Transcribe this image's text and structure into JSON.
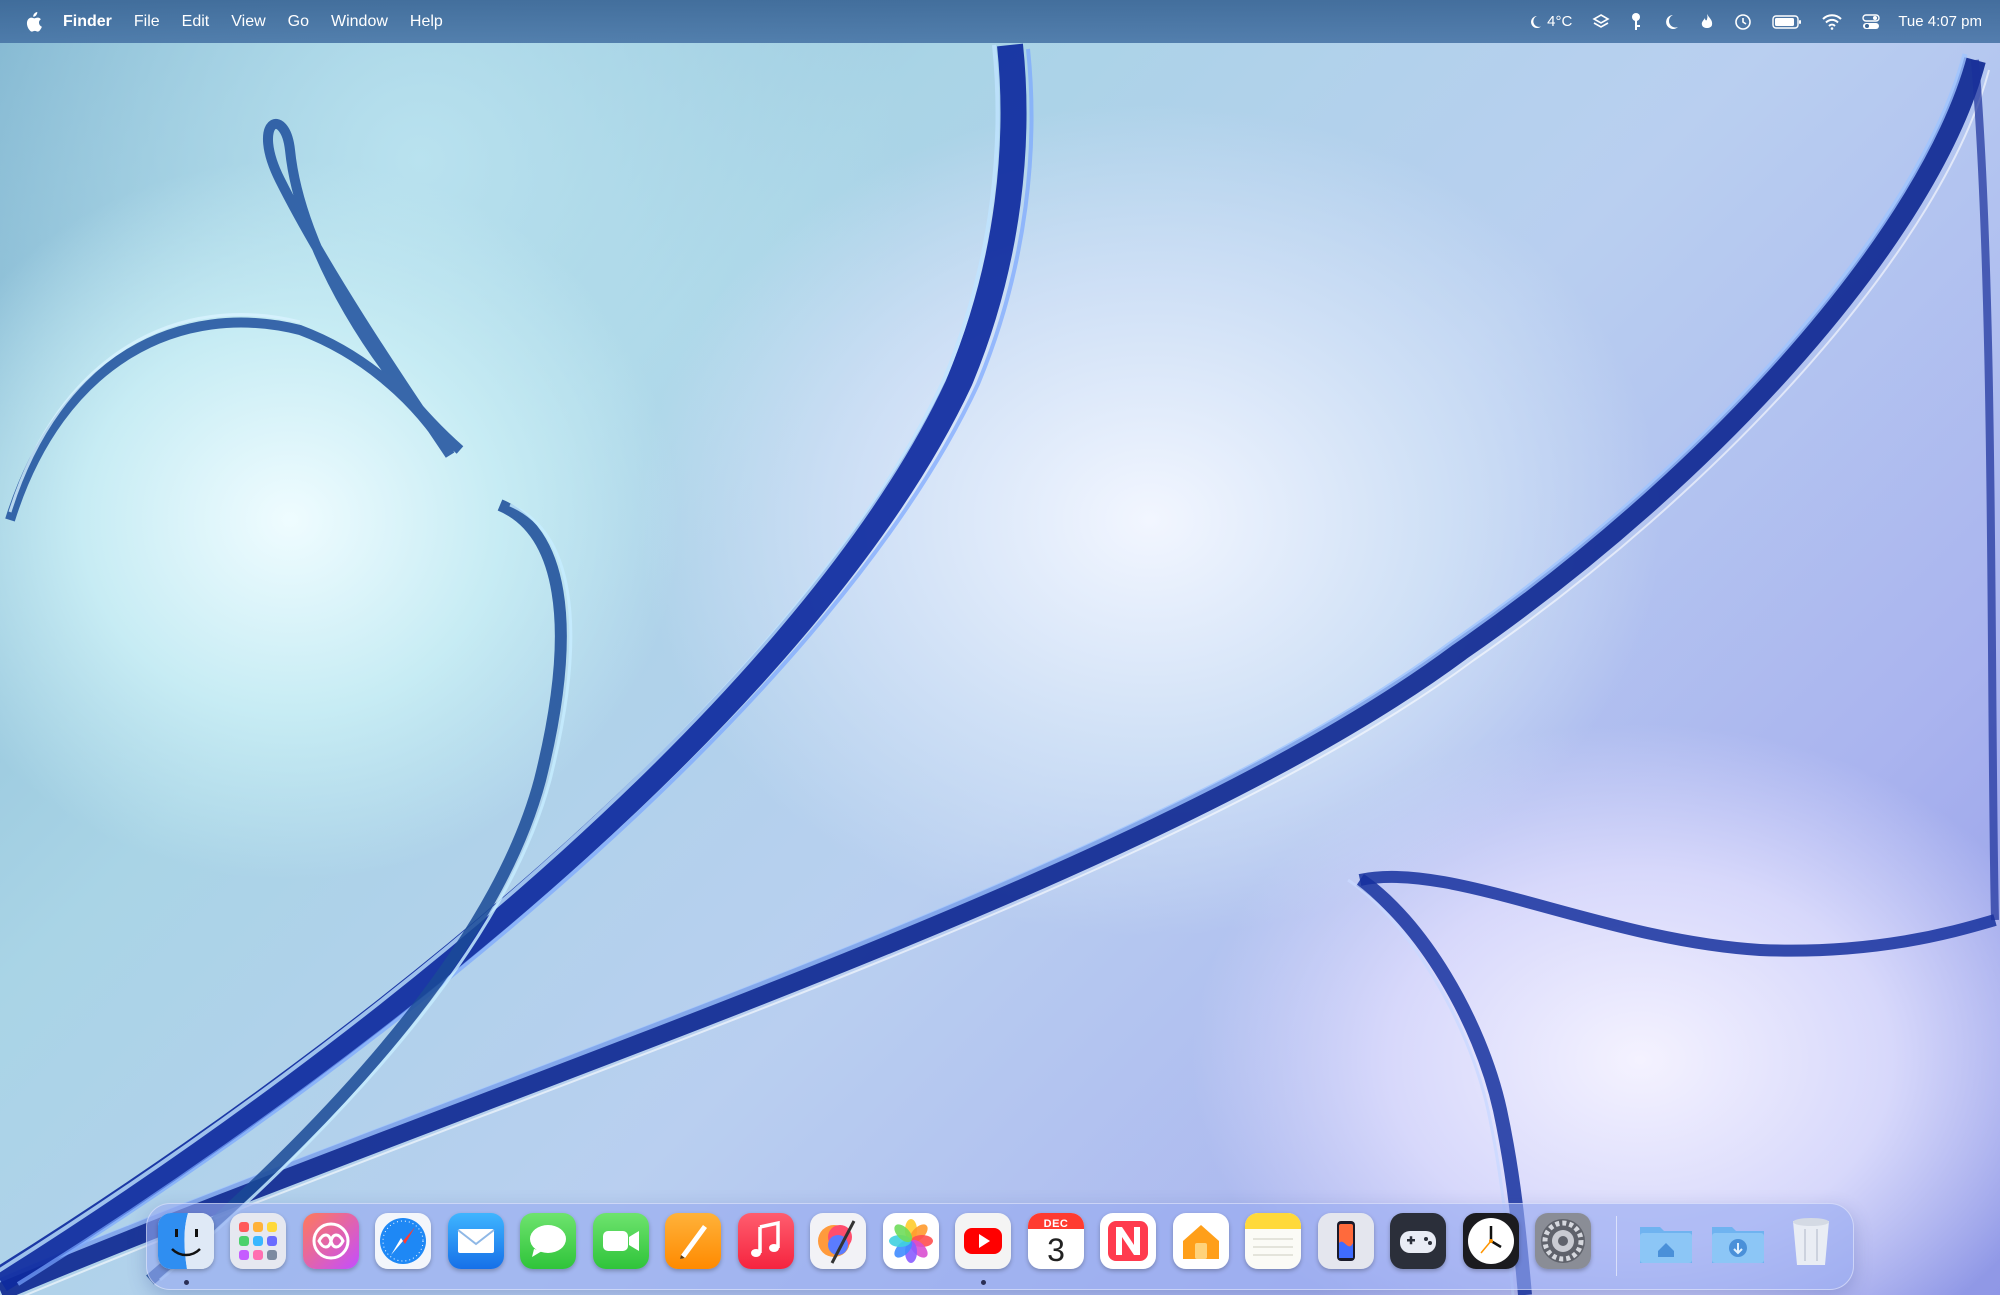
{
  "menubar": {
    "apple_glyph": "",
    "app_name": "Finder",
    "menus": [
      "File",
      "Edit",
      "View",
      "Go",
      "Window",
      "Help"
    ],
    "weather": "4°C",
    "status_icons": [
      "weather-moon-icon",
      "layers-icon",
      "key-icon",
      "focus-moon-icon",
      "flame-icon",
      "time-machine-icon",
      "battery-icon",
      "wifi-icon",
      "control-center-icon"
    ],
    "clock": "Tue 4:07 pm"
  },
  "dock": {
    "apps": [
      {
        "name": "Finder",
        "icon": "finder-icon",
        "running": true
      },
      {
        "name": "Launchpad",
        "icon": "launchpad-icon",
        "running": false
      },
      {
        "name": "Infinity app",
        "icon": "infinity-icon",
        "running": false
      },
      {
        "name": "Safari",
        "icon": "safari-icon",
        "running": false
      },
      {
        "name": "Mail",
        "icon": "mail-icon",
        "running": false
      },
      {
        "name": "Messages",
        "icon": "messages-icon",
        "running": false
      },
      {
        "name": "FaceTime",
        "icon": "facetime-icon",
        "running": false
      },
      {
        "name": "Pages",
        "icon": "pages-icon",
        "running": false
      },
      {
        "name": "Music",
        "icon": "music-icon",
        "running": false
      },
      {
        "name": "Pixelmator Pro",
        "icon": "pixelmator-icon",
        "running": false
      },
      {
        "name": "Photos",
        "icon": "photos-icon",
        "running": false
      },
      {
        "name": "YouTube",
        "icon": "youtube-icon",
        "running": true
      },
      {
        "name": "Calendar",
        "icon": "calendar-icon",
        "running": false
      },
      {
        "name": "News",
        "icon": "news-icon",
        "running": false
      },
      {
        "name": "Home",
        "icon": "home-icon",
        "running": false
      },
      {
        "name": "Notes",
        "icon": "notes-icon",
        "running": false
      },
      {
        "name": "iPhone Mirroring",
        "icon": "iphone-mirroring-icon",
        "running": false
      },
      {
        "name": "Game Center",
        "icon": "game-controller-icon",
        "running": false
      },
      {
        "name": "Clock",
        "icon": "clock-icon",
        "running": false
      },
      {
        "name": "System Settings",
        "icon": "settings-gear-icon",
        "running": false
      }
    ],
    "calendar": {
      "month": "DEC",
      "day": "3"
    },
    "stacks": [
      {
        "name": "Home folder",
        "icon": "home-folder-icon"
      },
      {
        "name": "Downloads",
        "icon": "downloads-folder-icon"
      },
      {
        "name": "Trash",
        "icon": "trash-icon"
      }
    ]
  },
  "colors": {
    "menubar_bg": "#3a6696",
    "wallpaper_accent": "#1e3fbf",
    "dock_bg": "#96aaf0"
  }
}
